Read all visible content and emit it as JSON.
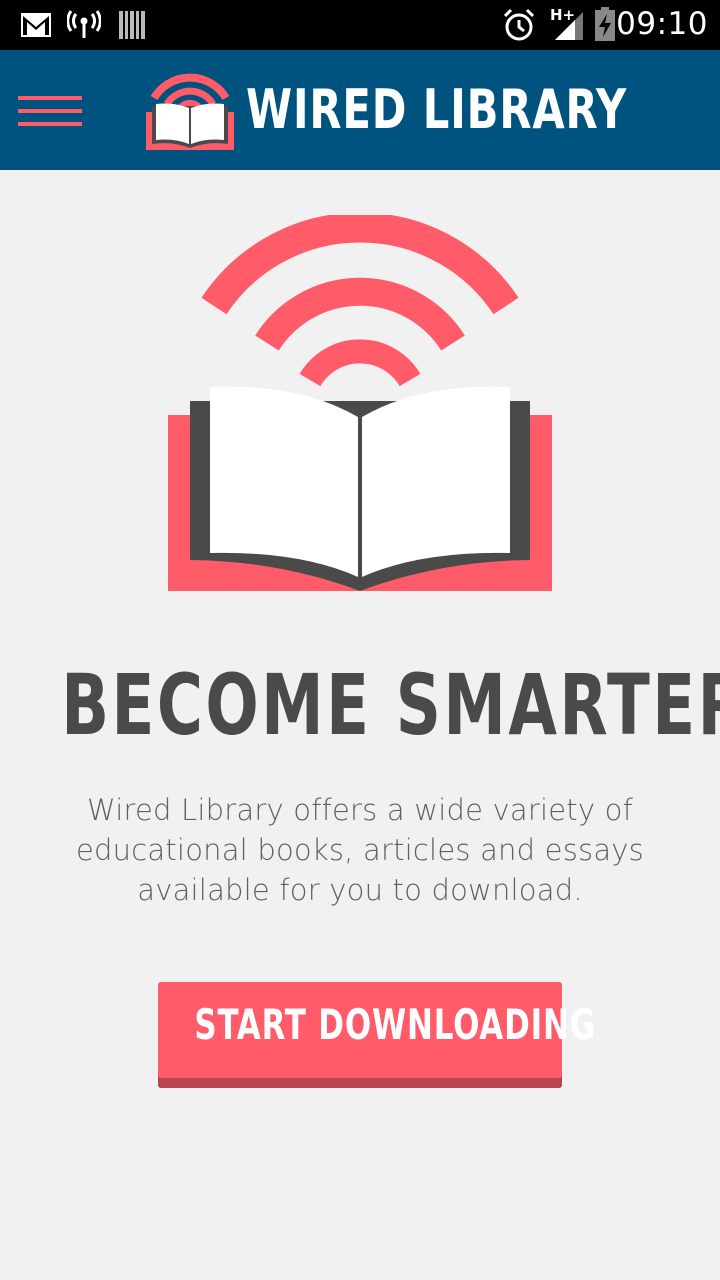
{
  "status_bar": {
    "time": "09:10",
    "network_type": "H+",
    "icons": [
      "gmail-icon",
      "hotspot-icon",
      "barcode-icon",
      "alarm-icon",
      "signal-icon",
      "battery-charging-icon"
    ]
  },
  "app_bar": {
    "title": "WIRED LIBRARY",
    "menu_icon": "hamburger-menu-icon",
    "logo_icon": "wireless-book-icon"
  },
  "hero": {
    "icon": "wireless-book-icon",
    "headline": "BECOME SMARTER",
    "description": "Wired Library offers a wide variety of educational books, articles and essays available for you to download.",
    "cta_label": "START DOWNLOADING"
  },
  "colors": {
    "app_bar": "#00527f",
    "accent": "#ff5b69",
    "accent_dark": "#b84754",
    "background": "#f1f1f1",
    "headline_text": "#4a4a4a",
    "body_text": "#5f5f5f"
  }
}
